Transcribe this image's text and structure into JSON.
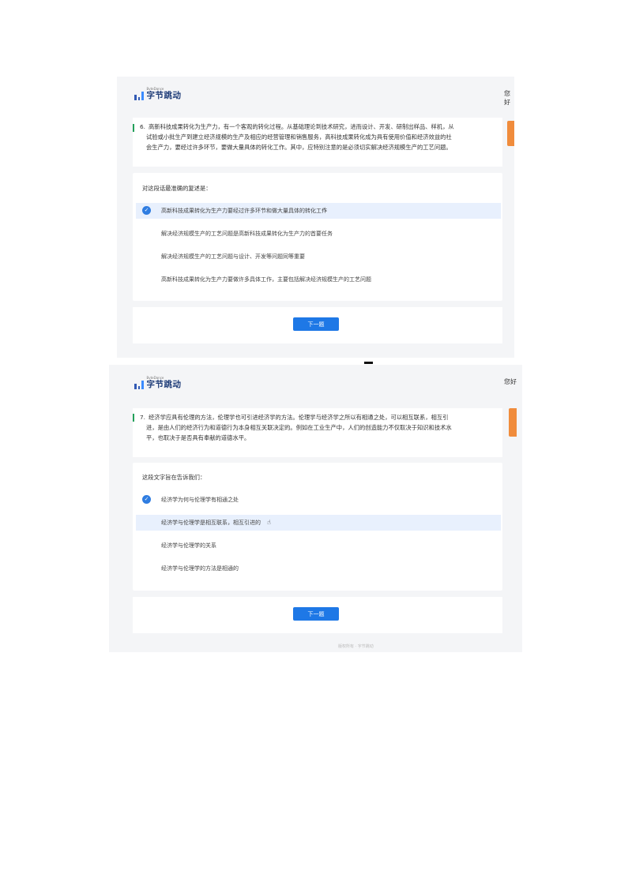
{
  "screens": [
    {
      "logo": {
        "en": "ByteDance",
        "cn": "字节跳动"
      },
      "greeting": "您好",
      "question": {
        "number": "6.",
        "lines": [
          "高新科技成果转化为生产力，有一个客观的转化过程。从基础理论到技术研究，进而设计、开发、研制出样品、样机，从",
          "试验或小批生产到建立经济规模的生产及相应的经营管理和销售服务，高科技成果转化成为具有使用价值和经济效益的社",
          "会生产力，要经过许多环节，要做大量具体的转化工作。其中，应特别注意的是必须切实解决经济规模生产的工艺问题。"
        ]
      },
      "prompt": "对这段话最准确的复述是：",
      "options": [
        {
          "text": "高新科技成果转化为生产力要经过许多环节和做大量具体的转化工作",
          "selected": true
        },
        {
          "text": "解决经济规模生产的工艺问题是高新科技成果转化为生产力的首要任务",
          "selected": false
        },
        {
          "text": "解决经济规模生产的工艺问题与设计、开发等问题同等重要",
          "selected": false
        },
        {
          "text": "高新科技成果转化为生产力要做许多具体工作，主要包括解决经济规模生产的工艺问题",
          "selected": false
        }
      ],
      "next_label": "下一题"
    },
    {
      "logo": {
        "en": "ByteDance",
        "cn": "字节跳动"
      },
      "greeting": "您好",
      "question": {
        "number": "7.",
        "lines": [
          "经济学应具有伦理的方法，伦理学也可引进经济学的方法。伦理学与经济学之所以有相通之处，可以相互联系，相互引",
          "进，是由人们的经济行为和道德行为本身相互关联决定的。例如在工业生产中，人们的创造能力不仅取决于知识和技术水",
          "平，也取决于是否具有奉献的道德水平。"
        ]
      },
      "prompt": "这段文字旨在告诉我们：",
      "options": [
        {
          "text": "经济学为何与伦理学有相通之处",
          "selected": true
        },
        {
          "text": "经济学与伦理学是相互联系，相互引进的",
          "selected": false
        },
        {
          "text": "经济学与伦理学的关系",
          "selected": false
        },
        {
          "text": "经济学与伦理学的方法是相通的",
          "selected": false
        }
      ],
      "next_label": "下一题",
      "footer": "版权所有 · 字节跳动"
    }
  ],
  "colors": {
    "accent_blue": "#1e78e6",
    "check_blue": "#2f7de1",
    "question_bar_green": "#23a05a",
    "orange_tab": "#f08c3c",
    "highlight_row": "#e8f0fd"
  }
}
